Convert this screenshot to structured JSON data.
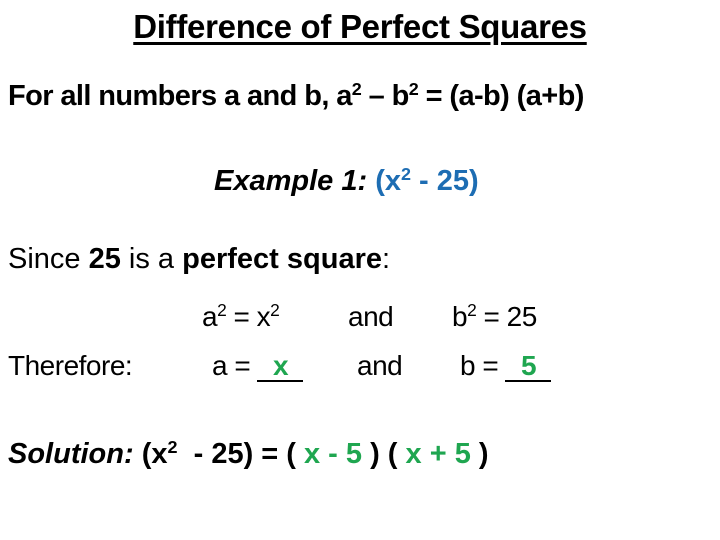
{
  "title": "Difference of Perfect Squares",
  "rule": {
    "prefix": "For all numbers a and b, a",
    "exp1": "2",
    "mid": " – b",
    "exp2": "2",
    "suffix": " = (a-b) (a+b)"
  },
  "example": {
    "label": "Example 1:",
    "expr_open": " (x",
    "expr_exp": "2",
    "expr_rest": "  - 25)"
  },
  "since": {
    "t1": "Since ",
    "b1": "25",
    "t2": " is a ",
    "b2": "perfect square",
    "t3": ":"
  },
  "equations": {
    "a_sq_left": "a",
    "a_sq_exp": "2",
    "a_sq_mid": " = x",
    "a_sq_exp2": "2",
    "and1": "and",
    "b_sq_left": "b",
    "b_sq_exp": "2",
    "b_sq_right": " = 25"
  },
  "therefore": {
    "label": "Therefore:",
    "a_label": "a = ",
    "a_answer": "x",
    "and2": "and",
    "b_label": "b = ",
    "b_answer": "5"
  },
  "solution": {
    "label": "Solution:",
    "lhs_open": " (x",
    "lhs_exp": "2",
    "lhs_rest": "  - 25) = ( ",
    "factor1": "x - 5",
    "between": " ) ( ",
    "factor2": "x + 5",
    "close": " )"
  },
  "colors": {
    "example_blue": "#1d6db3",
    "answer_green": "#1fa650"
  }
}
